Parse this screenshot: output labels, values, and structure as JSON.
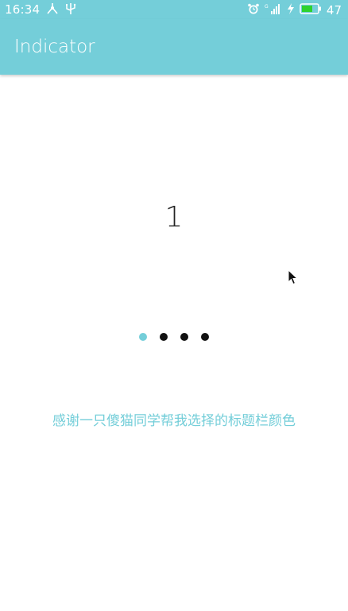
{
  "status_bar": {
    "time": "16:34",
    "battery": "47",
    "icons": [
      "usb-share-icon",
      "usb-icon",
      "alarm-icon",
      "signal-icon",
      "charging-icon",
      "battery-icon"
    ]
  },
  "app_bar": {
    "title": "Indicator"
  },
  "content": {
    "page_number": "1",
    "thanks_text": "感谢一只傻猫同学帮我选择的标题栏颜色"
  },
  "indicator": {
    "count": 4,
    "active_index": 0
  },
  "colors": {
    "accent": "#74ced9",
    "dot_inactive": "#111111",
    "text_dark": "#222222"
  }
}
